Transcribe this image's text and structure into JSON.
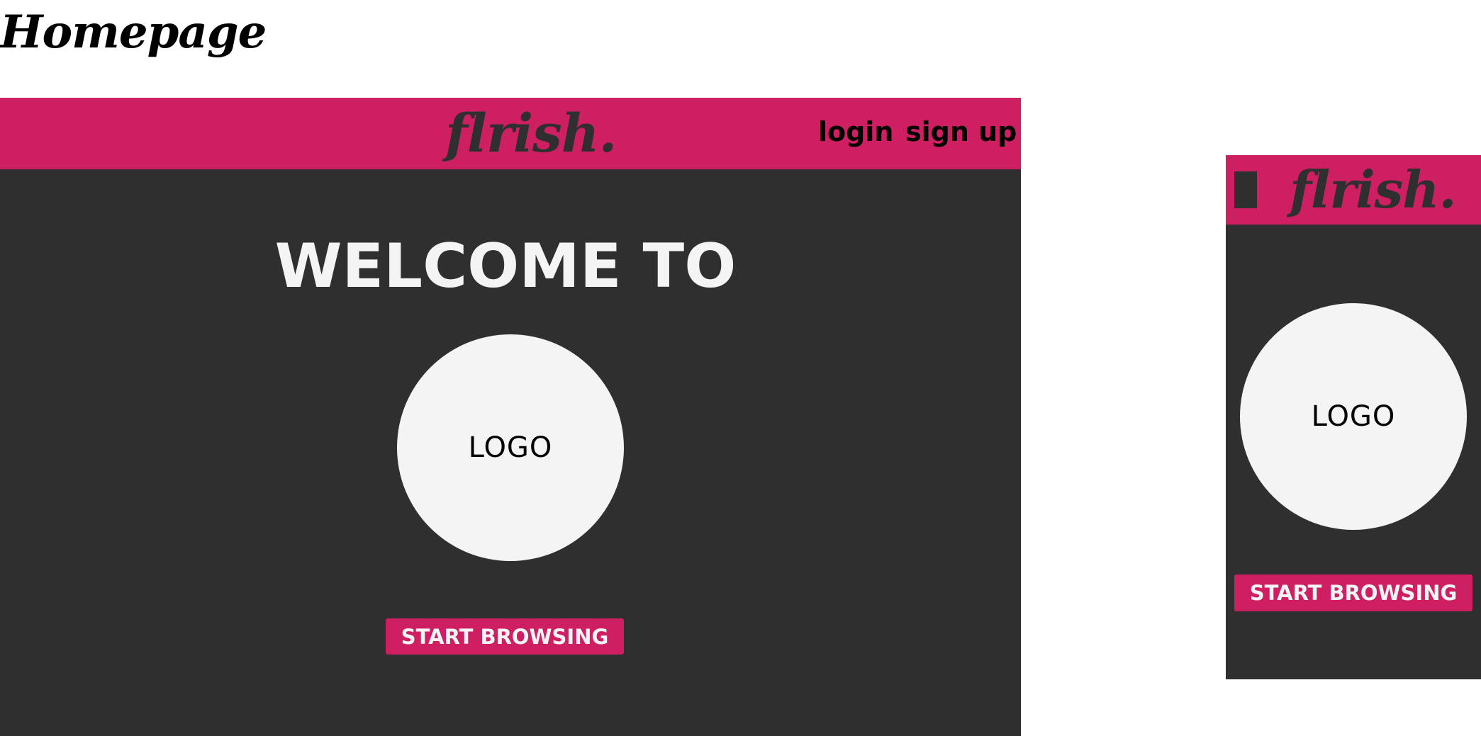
{
  "page": {
    "title": "Homepage"
  },
  "colors": {
    "accent": "#cf1f63",
    "background": "#302f30",
    "light": "#f4f4f4"
  },
  "desktop": {
    "brand": "flrish.",
    "nav": {
      "login_label": "login",
      "signup_label": "sign up"
    },
    "welcome_text": "WELCOME TO",
    "logo_text": "LOGO",
    "cta_label": "START BROWSING"
  },
  "mobile": {
    "menu_icon": "hamburger-menu-icon",
    "brand": "flrish.",
    "logo_text": "LOGO",
    "cta_label": "START BROWSING"
  }
}
